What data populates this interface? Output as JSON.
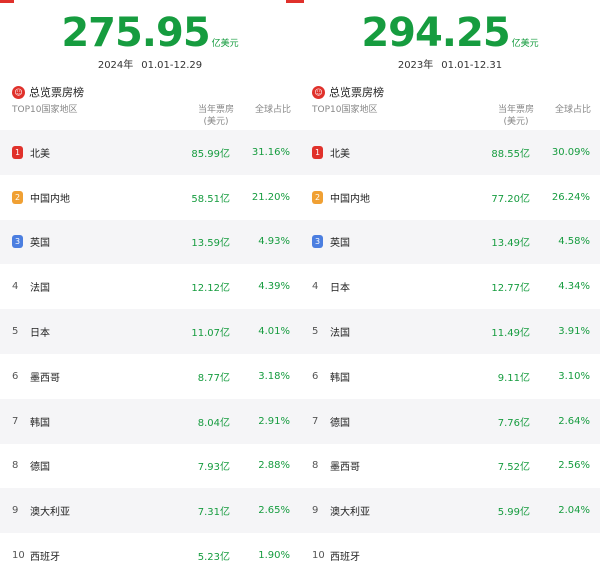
{
  "panels": [
    {
      "total": "275.95",
      "unit": "亿美元",
      "year": "2024年",
      "range": "01.01-12.29",
      "section_title": "总览票房榜",
      "col_region": "TOP10国家地区",
      "col_box_1": "当年票房",
      "col_box_2": "(美元)",
      "col_share": "全球占比",
      "rows": [
        {
          "rank": "1",
          "name": "北美",
          "box": "85.99亿",
          "share": "31.16%"
        },
        {
          "rank": "2",
          "name": "中国内地",
          "box": "58.51亿",
          "share": "21.20%"
        },
        {
          "rank": "3",
          "name": "英国",
          "box": "13.59亿",
          "share": "4.93%"
        },
        {
          "rank": "4",
          "name": "法国",
          "box": "12.12亿",
          "share": "4.39%"
        },
        {
          "rank": "5",
          "name": "日本",
          "box": "11.07亿",
          "share": "4.01%"
        },
        {
          "rank": "6",
          "name": "墨西哥",
          "box": "8.77亿",
          "share": "3.18%"
        },
        {
          "rank": "7",
          "name": "韩国",
          "box": "8.04亿",
          "share": "2.91%"
        },
        {
          "rank": "8",
          "name": "德国",
          "box": "7.93亿",
          "share": "2.88%"
        },
        {
          "rank": "9",
          "name": "澳大利亚",
          "box": "7.31亿",
          "share": "2.65%"
        },
        {
          "rank": "10",
          "name": "西班牙",
          "box": "5.23亿",
          "share": "1.90%"
        }
      ]
    },
    {
      "total": "294.25",
      "unit": "亿美元",
      "year": "2023年",
      "range": "01.01-12.31",
      "section_title": "总览票房榜",
      "col_region": "TOP10国家地区",
      "col_box_1": "当年票房",
      "col_box_2": "(美元)",
      "col_share": "全球占比",
      "rows": [
        {
          "rank": "1",
          "name": "北美",
          "box": "88.55亿",
          "share": "30.09%"
        },
        {
          "rank": "2",
          "name": "中国内地",
          "box": "77.20亿",
          "share": "26.24%"
        },
        {
          "rank": "3",
          "name": "英国",
          "box": "13.49亿",
          "share": "4.58%"
        },
        {
          "rank": "4",
          "name": "日本",
          "box": "12.77亿",
          "share": "4.34%"
        },
        {
          "rank": "5",
          "name": "法国",
          "box": "11.49亿",
          "share": "3.91%"
        },
        {
          "rank": "6",
          "name": "韩国",
          "box": "9.11亿",
          "share": "3.10%"
        },
        {
          "rank": "7",
          "name": "德国",
          "box": "7.76亿",
          "share": "2.64%"
        },
        {
          "rank": "8",
          "name": "墨西哥",
          "box": "7.52亿",
          "share": "2.56%"
        },
        {
          "rank": "9",
          "name": "澳大利亚",
          "box": "5.99亿",
          "share": "2.04%"
        },
        {
          "rank": "10",
          "name": "西班牙",
          "box": "",
          "share": ""
        }
      ]
    }
  ],
  "colors": {
    "accent_green": "#169c3f",
    "accent_red": "#e0312b",
    "rank2_orange": "#f0a033",
    "rank3_blue": "#4b7ee0",
    "stripe": "#f5f5f7"
  }
}
